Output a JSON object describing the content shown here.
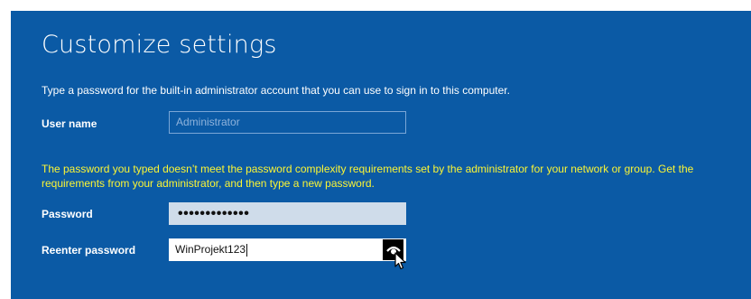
{
  "page": {
    "title": "Customize settings",
    "instruction": "Type a password for the built-in administrator account that you can use to sign in to this computer."
  },
  "form": {
    "username_label": "User name",
    "username_placeholder": "Administrator",
    "error_message": "The password you typed doesn’t meet the password complexity requirements set by the administrator for your network or group. Get the requirements from your administrator, and then type a new password.",
    "password_label": "Password",
    "password_masked": "•••••••••••••",
    "reenter_label": "Reenter password",
    "reenter_value": "WinProjekt123"
  },
  "icons": {
    "reveal": "eye-icon",
    "pointer": "mouse-cursor-icon"
  },
  "colors": {
    "panel_background": "#0b5aa5",
    "error_text": "#fbf535",
    "password_field": "#cfdcea"
  }
}
